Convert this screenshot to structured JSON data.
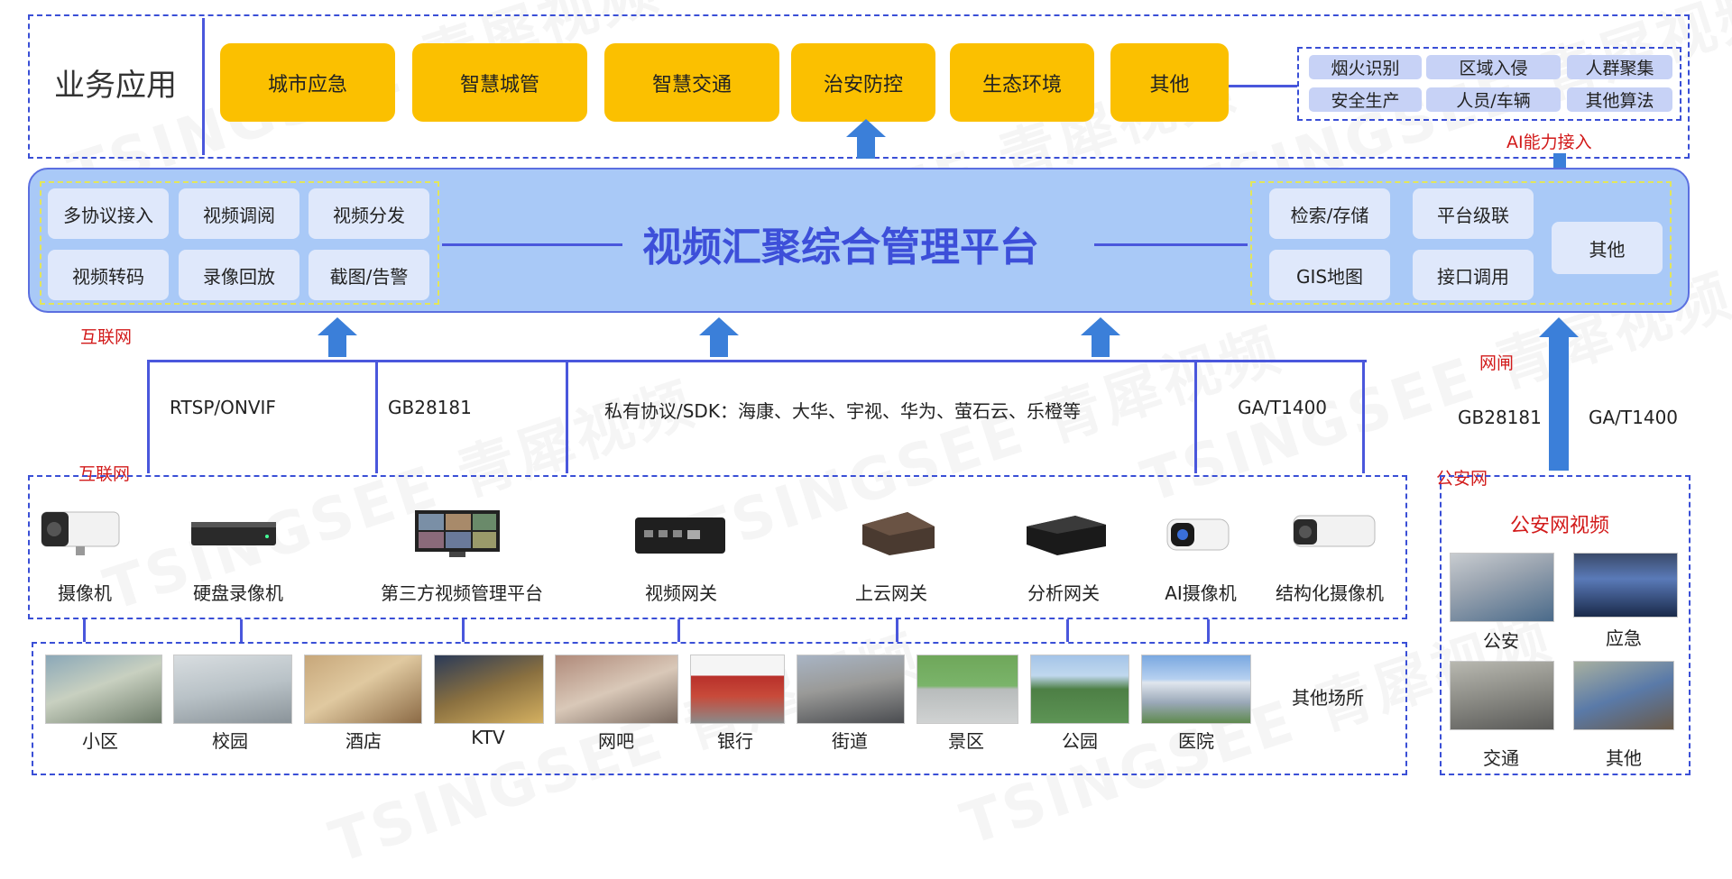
{
  "business": {
    "title": "业务应用",
    "apps": [
      "城市应急",
      "智慧城管",
      "智慧交通",
      "治安防控",
      "生态环境",
      "其他"
    ],
    "ai_algorithms": [
      "烟火识别",
      "区域入侵",
      "人群聚集",
      "安全生产",
      "人员/车辆",
      "其他算法"
    ],
    "ai_access_label": "AI能力接入"
  },
  "platform": {
    "title": "视频汇聚综合管理平台",
    "left_features": [
      "多协议接入",
      "视频调阅",
      "视频分发",
      "视频转码",
      "录像回放",
      "截图/告警"
    ],
    "right_features": [
      "检索/存储",
      "平台级联",
      "GIS地图",
      "接口调用"
    ],
    "right_other": "其他"
  },
  "network": {
    "internet_top": "互联网",
    "internet_bottom": "互联网",
    "gateway": "网闸",
    "public_security": "公安网"
  },
  "protocols": [
    "RTSP/ONVIF",
    "GB28181",
    "私有协议/SDK：海康、大华、宇视、华为、萤石云、乐橙等",
    "GA/T1400"
  ],
  "ps_protocols": [
    "GB28181",
    "GA/T1400"
  ],
  "devices": [
    "摄像机",
    "硬盘录像机",
    "第三方视频管理平台",
    "视频网关",
    "上云网关",
    "分析网关",
    "AI摄像机",
    "结构化摄像机"
  ],
  "places": [
    "小区",
    "校园",
    "酒店",
    "KTV",
    "网吧",
    "银行",
    "街道",
    "景区",
    "公园",
    "医院"
  ],
  "places_other": "其他场所",
  "public_security_video": {
    "title": "公安网视频",
    "items": [
      "公安",
      "应急",
      "交通",
      "其他"
    ]
  },
  "watermark": [
    "TSINGSEE 青犀视频"
  ],
  "colors": {
    "app_yellow": "#fbc000",
    "line_blue": "#4a57dc",
    "platform_bg": "#a9c9f7",
    "title_blue": "#3d4fd9",
    "arrow_blue": "#3b7fd9",
    "red": "#d21a1a"
  }
}
